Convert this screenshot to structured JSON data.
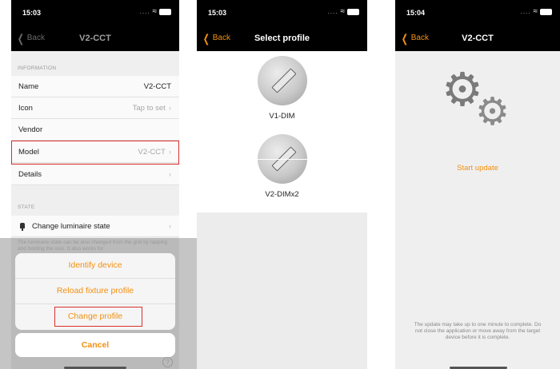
{
  "panel1": {
    "status": {
      "time": "15:03"
    },
    "nav": {
      "back": "Back",
      "title": "V2-CCT"
    },
    "info_header": "INFORMATION",
    "rows": [
      {
        "label": "Name",
        "value": "V2-CCT"
      },
      {
        "label": "Icon",
        "value": "Tap to set"
      },
      {
        "label": "Vendor",
        "value": ""
      },
      {
        "label": "Model",
        "value": "V2-CCT"
      },
      {
        "label": "Details",
        "value": ""
      }
    ],
    "state_header": "STATE",
    "state_row": "Change luminaire state",
    "note": "The luminaire state can be also changed from the grid by tapping and holding the icon. It also works for",
    "sheet": {
      "options": [
        "Identify device",
        "Reload fixture profile",
        "Change profile"
      ],
      "cancel": "Cancel"
    }
  },
  "panel2": {
    "status": {
      "time": "15:03"
    },
    "nav": {
      "back": "Back",
      "title": "Select profile"
    },
    "profiles": [
      "V1-DIM",
      "V2-DIMx2"
    ]
  },
  "panel3": {
    "status": {
      "time": "15:04"
    },
    "nav": {
      "back": "Back",
      "title": "V2-CCT"
    },
    "start": "Start update",
    "info": "The update may take up to one minute to complete. Do not close the application or move away from the target device before it is complete."
  },
  "colors": {
    "accent": "#f29111",
    "highlight": "#d9302c"
  }
}
